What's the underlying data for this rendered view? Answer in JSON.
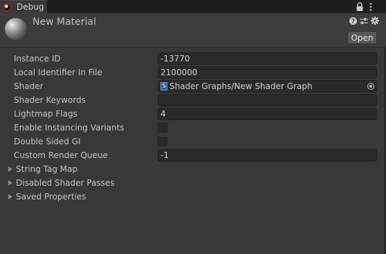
{
  "tab": {
    "label": "Debug",
    "icon": "unity-logo-icon"
  },
  "header": {
    "title": "New Material",
    "open_label": "Open",
    "icons": [
      "help-icon",
      "preset-sliders-icon",
      "gear-icon"
    ]
  },
  "properties": {
    "instance_id": {
      "label": "Instance ID",
      "value": "-13770"
    },
    "local_identifier": {
      "label": "Local Identifier In File",
      "value": "2100000"
    },
    "shader": {
      "label": "Shader",
      "value": "Shader Graphs/New Shader Graph",
      "icon_glyph": "S"
    },
    "shader_keywords": {
      "label": "Shader Keywords",
      "value": ""
    },
    "lightmap_flags": {
      "label": "Lightmap Flags",
      "value": "4"
    },
    "enable_instancing": {
      "label": "Enable Instancing Variants",
      "checked": false
    },
    "double_sided_gi": {
      "label": "Double Sided GI",
      "checked": false
    },
    "render_queue": {
      "label": "Custom Render Queue",
      "value": "-1"
    }
  },
  "foldouts": {
    "string_tag_map": "String Tag Map",
    "disabled_shader_passes": "Disabled Shader Passes",
    "saved_properties": "Saved Properties"
  }
}
